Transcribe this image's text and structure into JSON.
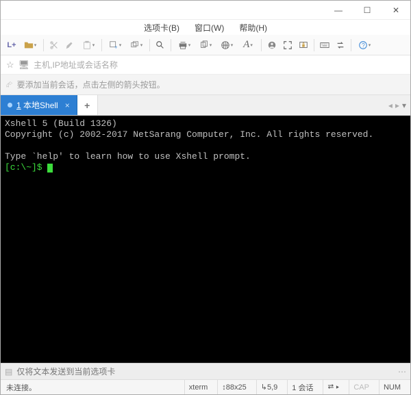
{
  "window": {
    "minimize": "—",
    "maximize": "☐",
    "close": "✕"
  },
  "menu": {
    "tabs": "选项卡(B)",
    "window": "窗口(W)",
    "help": "帮助(H)"
  },
  "toolbar": {
    "lplus": "L+"
  },
  "address": {
    "placeholder": "主机,IP地址或会话名称"
  },
  "hint": {
    "text": "要添加当前会话，点击左侧的箭头按钮。"
  },
  "tab": {
    "index": "1",
    "label": "本地Shell"
  },
  "terminal": {
    "line1": "Xshell 5 (Build 1326)",
    "line2": "Copyright (c) 2002-2017 NetSarang Computer, Inc. All rights reserved.",
    "line3": "",
    "line4": "Type `help' to learn how to use Xshell prompt.",
    "prompt": "[c:\\~]$ "
  },
  "sendbar": {
    "placeholder": "仅将文本发送到当前选项卡"
  },
  "status": {
    "conn": "未连接。",
    "term": "xterm",
    "size": "88x25",
    "cursor": "5,9",
    "sessions": "1 会话",
    "cap": "CAP",
    "num": "NUM"
  }
}
